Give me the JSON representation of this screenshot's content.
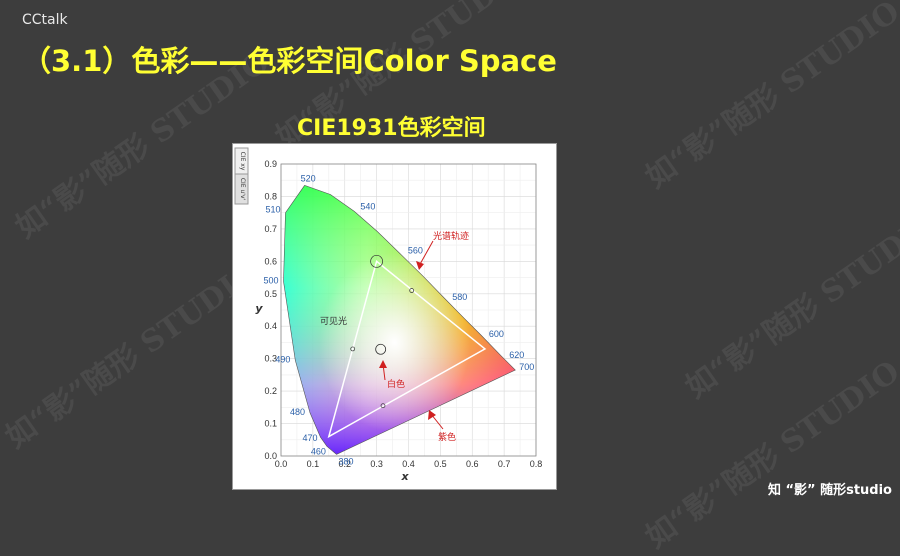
{
  "brand": "CCtalk",
  "slide_title": "（3.1）色彩——色彩空间Color Space",
  "diagram_title": "CIE1931色彩空间",
  "chart": {
    "tabs": [
      "CIE xy",
      "CIE u'v'"
    ],
    "xlabel": "x",
    "ylabel": "y",
    "x_ticks": [
      "0.0",
      "0.1",
      "0.2",
      "0.3",
      "0.4",
      "0.5",
      "0.6",
      "0.7",
      "0.8"
    ],
    "y_ticks": [
      "0.0",
      "0.1",
      "0.2",
      "0.3",
      "0.4",
      "0.5",
      "0.6",
      "0.7",
      "0.8",
      "0.9"
    ],
    "wavelengths": [
      {
        "label": "380",
        "x": 0.174,
        "y": 0.005
      },
      {
        "label": "460",
        "x": 0.144,
        "y": 0.03
      },
      {
        "label": "470",
        "x": 0.124,
        "y": 0.058
      },
      {
        "label": "480",
        "x": 0.091,
        "y": 0.133
      },
      {
        "label": "490",
        "x": 0.045,
        "y": 0.295
      },
      {
        "label": "500",
        "x": 0.008,
        "y": 0.538
      },
      {
        "label": "510",
        "x": 0.014,
        "y": 0.75
      },
      {
        "label": "520",
        "x": 0.074,
        "y": 0.834
      },
      {
        "label": "540",
        "x": 0.23,
        "y": 0.754
      },
      {
        "label": "560",
        "x": 0.373,
        "y": 0.624
      },
      {
        "label": "580",
        "x": 0.512,
        "y": 0.487
      },
      {
        "label": "600",
        "x": 0.627,
        "y": 0.373
      },
      {
        "label": "620",
        "x": 0.691,
        "y": 0.308
      },
      {
        "label": "700",
        "x": 0.735,
        "y": 0.265
      }
    ],
    "annotations": {
      "spectral_locus": "光谱轨迹",
      "visible": "可见光",
      "white": "白色",
      "purple": "紫色"
    }
  },
  "logo_text": "知 “影” 随形studio",
  "colors": {
    "title": "#ffff33",
    "background": "#3d3d3d"
  }
}
